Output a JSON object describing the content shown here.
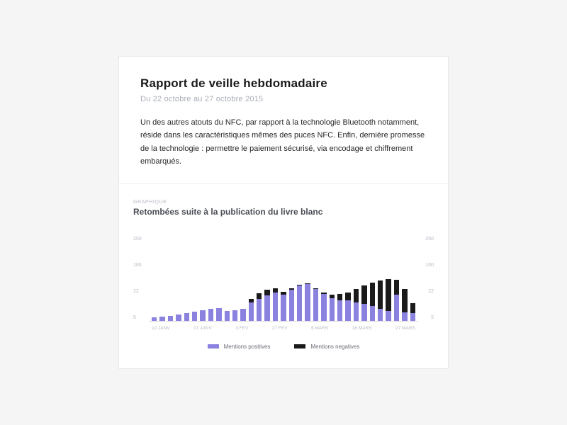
{
  "header": {
    "title": "Rapport de veille hebdomadaire",
    "date_range": "Du 22 octobre au 27 octobre 2015",
    "body": "Un des autres atouts du NFC, par rapport à la technologie Bluetooth notamment, réside dans les caractéristiques mêmes des puces NFC. Enfin, dernière promesse de la technologie : permettre le paiement sécurisé, via encodage et chiffrement embarqués."
  },
  "chart": {
    "eyebrow": "GRAPHIQUE",
    "title": "Retombées suite à la publication du livre blanc",
    "y_ticks": [
      "250",
      "100",
      "22",
      "5"
    ],
    "x_ticks": [
      "10 JANV",
      "17 JANV",
      "3 FEV",
      "27 FEV",
      "6 MARS",
      "16 MARS",
      "27 MARS"
    ],
    "legend": {
      "positive": "Mentions positives",
      "negative": "Mentions negatives"
    }
  },
  "chart_data": {
    "type": "bar",
    "title": "Retombées suite à la publication du livre blanc",
    "xlabel": "",
    "ylabel": "",
    "ylim": [
      0,
      250
    ],
    "x_ticks": [
      "10 JANV",
      "17 JANV",
      "3 FEV",
      "27 FEV",
      "6 MARS",
      "16 MARS",
      "27 MARS"
    ],
    "series": [
      {
        "name": "Mentions positives",
        "color": "#8b82e0",
        "values": [
          10,
          12,
          15,
          18,
          22,
          28,
          32,
          35,
          38,
          30,
          32,
          35,
          55,
          65,
          75,
          85,
          78,
          92,
          105,
          110,
          95,
          80,
          68,
          62,
          60,
          55,
          50,
          45,
          35,
          30,
          78,
          25,
          22
        ]
      },
      {
        "name": "Mentions negatives",
        "color": "#1a1a1a",
        "values": [
          0,
          0,
          0,
          0,
          0,
          0,
          0,
          0,
          0,
          0,
          0,
          0,
          10,
          18,
          18,
          12,
          8,
          6,
          3,
          2,
          2,
          5,
          10,
          18,
          25,
          40,
          55,
          70,
          85,
          95,
          45,
          70,
          30
        ]
      }
    ]
  }
}
